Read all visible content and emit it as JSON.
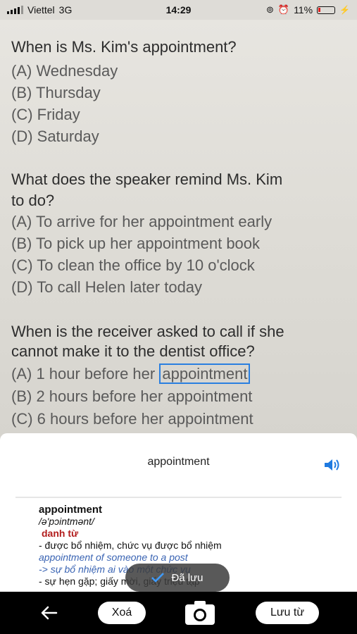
{
  "status_bar": {
    "carrier": "Viettel",
    "network": "3G",
    "time": "14:29",
    "battery": "11%"
  },
  "page": {
    "questions": [
      {
        "text_lines": [
          "When is Ms. Kim's appointment?"
        ],
        "options": [
          "(A) Wednesday",
          "(B) Thursday",
          "(C) Friday",
          "(D) Saturday"
        ]
      },
      {
        "text_lines": [
          "What does the speaker remind Ms. Kim",
          "to do?"
        ],
        "options": [
          "(A) To arrive for her appointment early",
          "(B) To pick up her appointment book",
          "(C) To clean the office by 10 o'clock",
          "(D) To call Helen later today"
        ]
      },
      {
        "text_lines": [
          "When is the receiver asked to call if she",
          "cannot make it to the dentist office?"
        ],
        "options": [
          "(A) 1 hour before her",
          "(B) 2 hours before her appointment",
          "(C) 6 hours before her appointment"
        ],
        "highlighted_word": "appointment"
      }
    ]
  },
  "dictionary": {
    "search_word": "appointment",
    "entry_word": "appointment",
    "phonetic": "/ə'pɔintmənt/",
    "part_of_speech": "danh từ",
    "lines": [
      "- được bổ nhiệm, chức vụ được bổ nhiệm",
      "appointment of someone to a post",
      "-> sự bổ nhiệm ai vào một chức vụ",
      "- sự hẹn gặp; giấy mời, giấy triệu tập"
    ]
  },
  "toast": {
    "label": "Đã lưu"
  },
  "toolbar": {
    "delete_label": "Xoá",
    "save_word_label": "Lưu từ"
  },
  "colors": {
    "highlight": "#2a7fe0",
    "pos": "#b21d1d",
    "example": "#3a64b3",
    "toolbar": "#000000"
  }
}
